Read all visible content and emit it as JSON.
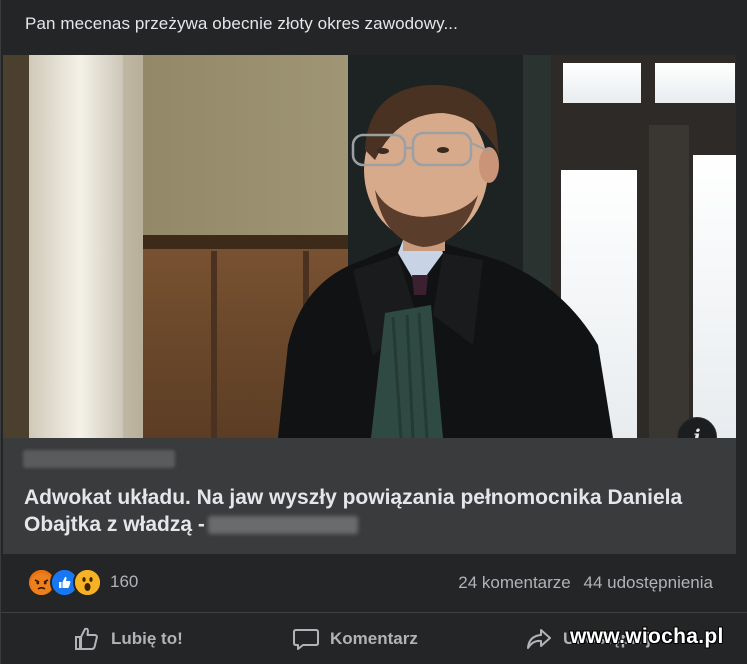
{
  "post": {
    "text": "Pan mecenas przeżywa obecnie złoty okres zawodowy..."
  },
  "link_preview": {
    "domain": "",
    "title": "Adwokat układu. Na jaw wyszły powiązania pełnomocnika Daniela Obajtka z władzą -",
    "title_source": "",
    "info_icon": "i"
  },
  "reactions": {
    "icons": [
      "angry-icon",
      "like-icon",
      "wow-icon"
    ],
    "count": "160",
    "comments": "24 komentarze",
    "shares": "44 udostępnienia"
  },
  "actions": {
    "like_label": "Lubię to!",
    "comment_label": "Komentarz",
    "share_label": "Udostępnij"
  },
  "watermark": "www.wiocha.pl",
  "colors": {
    "background": "#242526",
    "link_box": "#3a3b3c",
    "text_primary": "#e4e6eb",
    "text_secondary": "#b0b3b8",
    "like_blue": "#1877f2",
    "angry_orange": "#e9710f",
    "wow_yellow": "#f7b125"
  }
}
